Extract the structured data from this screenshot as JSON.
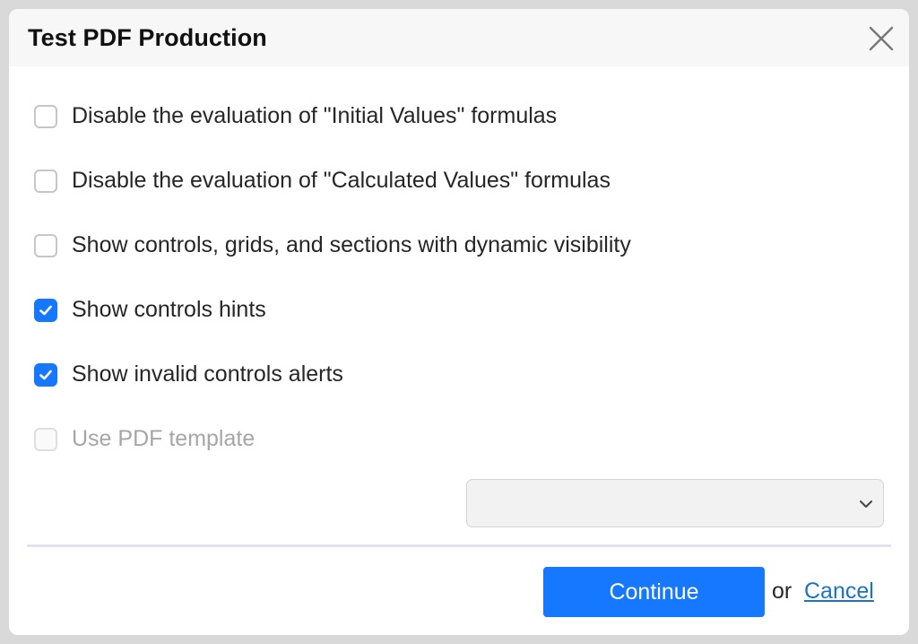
{
  "dialog": {
    "title": "Test PDF Production",
    "close_icon": "close-icon"
  },
  "options": [
    {
      "label": "Disable the evaluation of \"Initial Values\" formulas",
      "checked": false,
      "disabled": false
    },
    {
      "label": "Disable the evaluation of \"Calculated Values\" formulas",
      "checked": false,
      "disabled": false
    },
    {
      "label": "Show controls, grids, and sections with dynamic visibility",
      "checked": false,
      "disabled": false
    },
    {
      "label": "Show controls hints",
      "checked": true,
      "disabled": false
    },
    {
      "label": "Show invalid controls alerts",
      "checked": true,
      "disabled": false
    },
    {
      "label": "Use PDF template",
      "checked": false,
      "disabled": true
    }
  ],
  "template_select": {
    "value": "",
    "icon": "chevron-down-icon"
  },
  "footer": {
    "continue_label": "Continue",
    "or_text": "or",
    "cancel_label": "Cancel"
  },
  "colors": {
    "accent": "#1677ff",
    "link": "#1a73c8",
    "divider": "#e3e2f0"
  }
}
